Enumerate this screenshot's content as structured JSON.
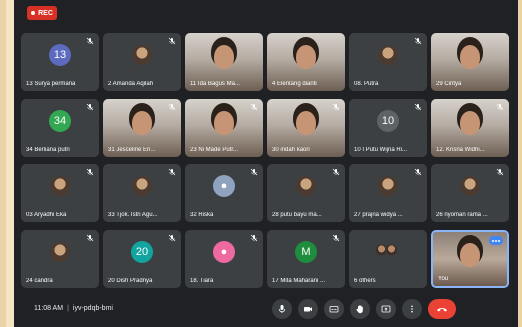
{
  "recording_badge": {
    "label": "REC",
    "color": "#d93025"
  },
  "tiles": [
    {
      "name": "13 Surya permana",
      "type": "avatar",
      "initials": "13",
      "color": "#5c6bc0",
      "muted": true
    },
    {
      "name": "2 Amanda Aqilah",
      "type": "photo",
      "muted": true
    },
    {
      "name": "11 Ida Bagus Ma...",
      "type": "video",
      "muted": false
    },
    {
      "name": "4 Elentang dianti",
      "type": "video",
      "muted": false
    },
    {
      "name": "08. Putra",
      "type": "photo",
      "muted": true
    },
    {
      "name": "29 Cintya",
      "type": "video",
      "muted": false
    },
    {
      "name": "34 Berliana putri",
      "type": "avatar",
      "initials": "34",
      "color": "#33a852",
      "muted": true
    },
    {
      "name": "31 Jesceline Eri...",
      "type": "video",
      "muted": true
    },
    {
      "name": "23 Ni Made Putr...",
      "type": "video",
      "muted": true
    },
    {
      "name": "30 indah kaori",
      "type": "video",
      "muted": true
    },
    {
      "name": "10 I Putu Wijna Ri...",
      "type": "avatar",
      "initials": "10",
      "color": "#5f6368",
      "muted": true
    },
    {
      "name": "12. Krisna Widhi...",
      "type": "video",
      "muted": true
    },
    {
      "name": "03 Aryadhi Eka",
      "type": "photo",
      "muted": true
    },
    {
      "name": "33 Tjok. Istri Agu...",
      "type": "photo",
      "muted": true
    },
    {
      "name": "32 Riska",
      "type": "avatar",
      "initials": "●",
      "color": "#8fa3bf",
      "muted": true
    },
    {
      "name": "28 putu bayu ma...",
      "type": "photo",
      "muted": true
    },
    {
      "name": "27 prajna widya ...",
      "type": "photo",
      "muted": true
    },
    {
      "name": "26 nyoman rama ...",
      "type": "photo",
      "muted": true
    },
    {
      "name": "24 candra",
      "type": "photo",
      "muted": true
    },
    {
      "name": "20 Dish Pradnya",
      "type": "avatar",
      "initials": "20",
      "color": "#12a4a0",
      "muted": true
    },
    {
      "name": "18. Tiara",
      "type": "avatar",
      "initials": "●",
      "color": "#ec6aa0",
      "muted": true
    },
    {
      "name": "17 Mita Maharani ...",
      "type": "avatar",
      "initials": "M",
      "color": "#1e8e3e",
      "muted": true
    },
    {
      "name": "6 others",
      "type": "others",
      "muted": false
    },
    {
      "name": "You",
      "type": "self",
      "muted": false
    }
  ],
  "bottom_bar": {
    "time": "11:08 AM",
    "separator": "|",
    "meeting_code": "iyv-pdqb-bmi"
  },
  "controls": [
    {
      "name": "microphone",
      "icon": "mic-icon"
    },
    {
      "name": "camera",
      "icon": "camera-icon"
    },
    {
      "name": "captions",
      "icon": "captions-icon"
    },
    {
      "name": "raise-hand",
      "icon": "hand-icon"
    },
    {
      "name": "present",
      "icon": "present-icon"
    },
    {
      "name": "more-options",
      "icon": "more-vert-icon"
    }
  ],
  "end_call": {
    "icon": "end-call-icon",
    "color": "#ea4335"
  }
}
